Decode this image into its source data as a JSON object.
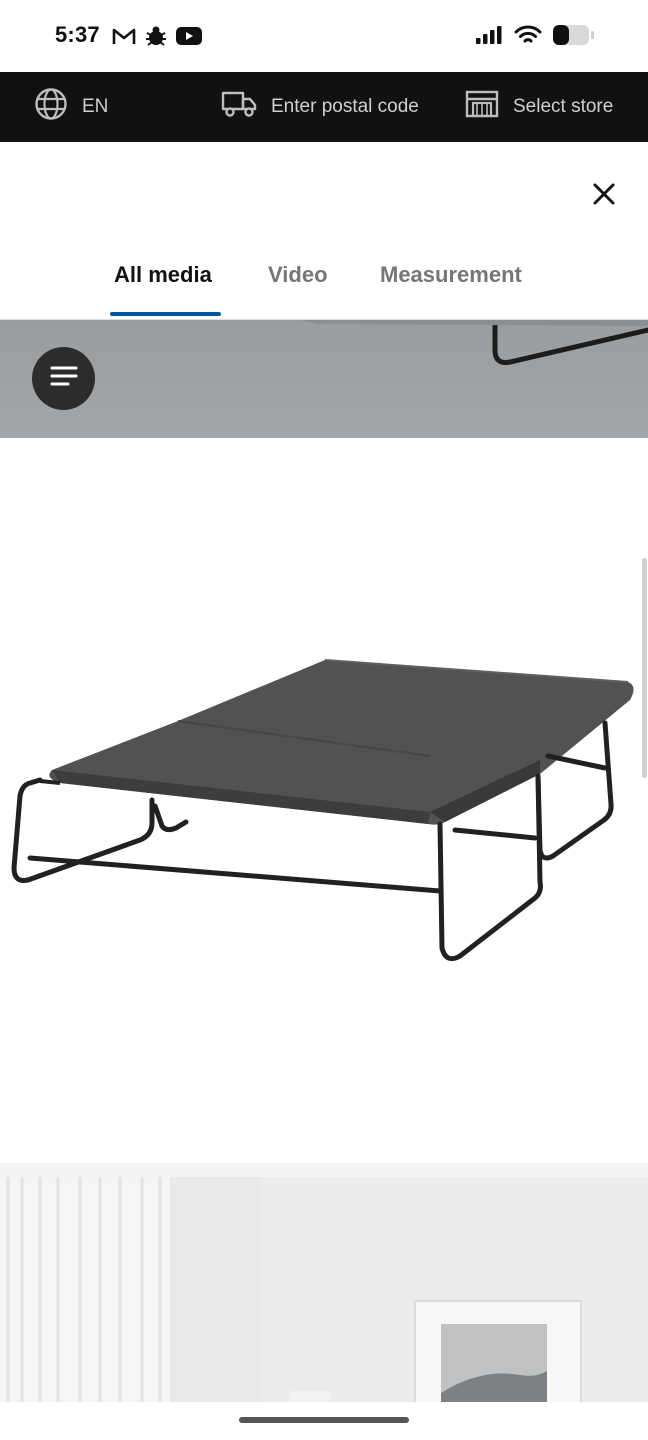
{
  "status_bar": {
    "time": "5:37",
    "app_icons": [
      "gmail-icon",
      "bug-icon",
      "youtube-icon"
    ],
    "system_icons": [
      "signal-icon",
      "wifi-icon",
      "battery-icon"
    ]
  },
  "top_nav": {
    "language": "EN",
    "postal_placeholder": "Enter postal code",
    "store_label": "Select store",
    "icons": [
      "globe-icon",
      "truck-icon",
      "store-icon"
    ]
  },
  "media_viewer": {
    "tabs": [
      {
        "label": "All media",
        "active": true
      },
      {
        "label": "Video",
        "active": false
      },
      {
        "label": "Measurement",
        "active": false
      }
    ],
    "accent_color": "#0058a3",
    "close_icon": "close-icon",
    "menu_icon": "menu-lines-icon"
  }
}
